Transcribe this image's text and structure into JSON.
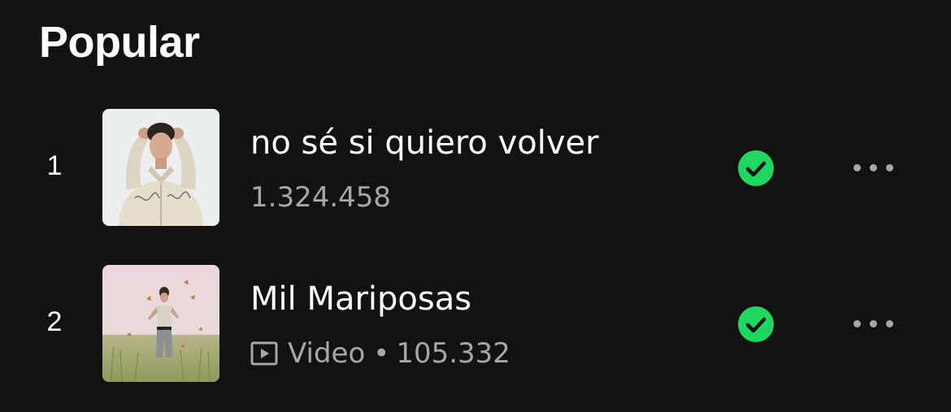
{
  "section": {
    "title": "Popular"
  },
  "colors": {
    "background": "#121212",
    "primary_text": "#ffffff",
    "secondary_text": "#a7a7a7",
    "accent_green": "#1ed760"
  },
  "tracks": [
    {
      "index": "1",
      "title": "no sé si quiero volver",
      "plays": "1.324.458",
      "downloaded": true,
      "has_video": false,
      "cover_icon": "album-cover-portrait"
    },
    {
      "index": "2",
      "title": "Mil Mariposas",
      "badge": "Video",
      "separator": "•",
      "plays": "105.332",
      "downloaded": true,
      "has_video": true,
      "cover_icon": "album-cover-field"
    }
  ]
}
